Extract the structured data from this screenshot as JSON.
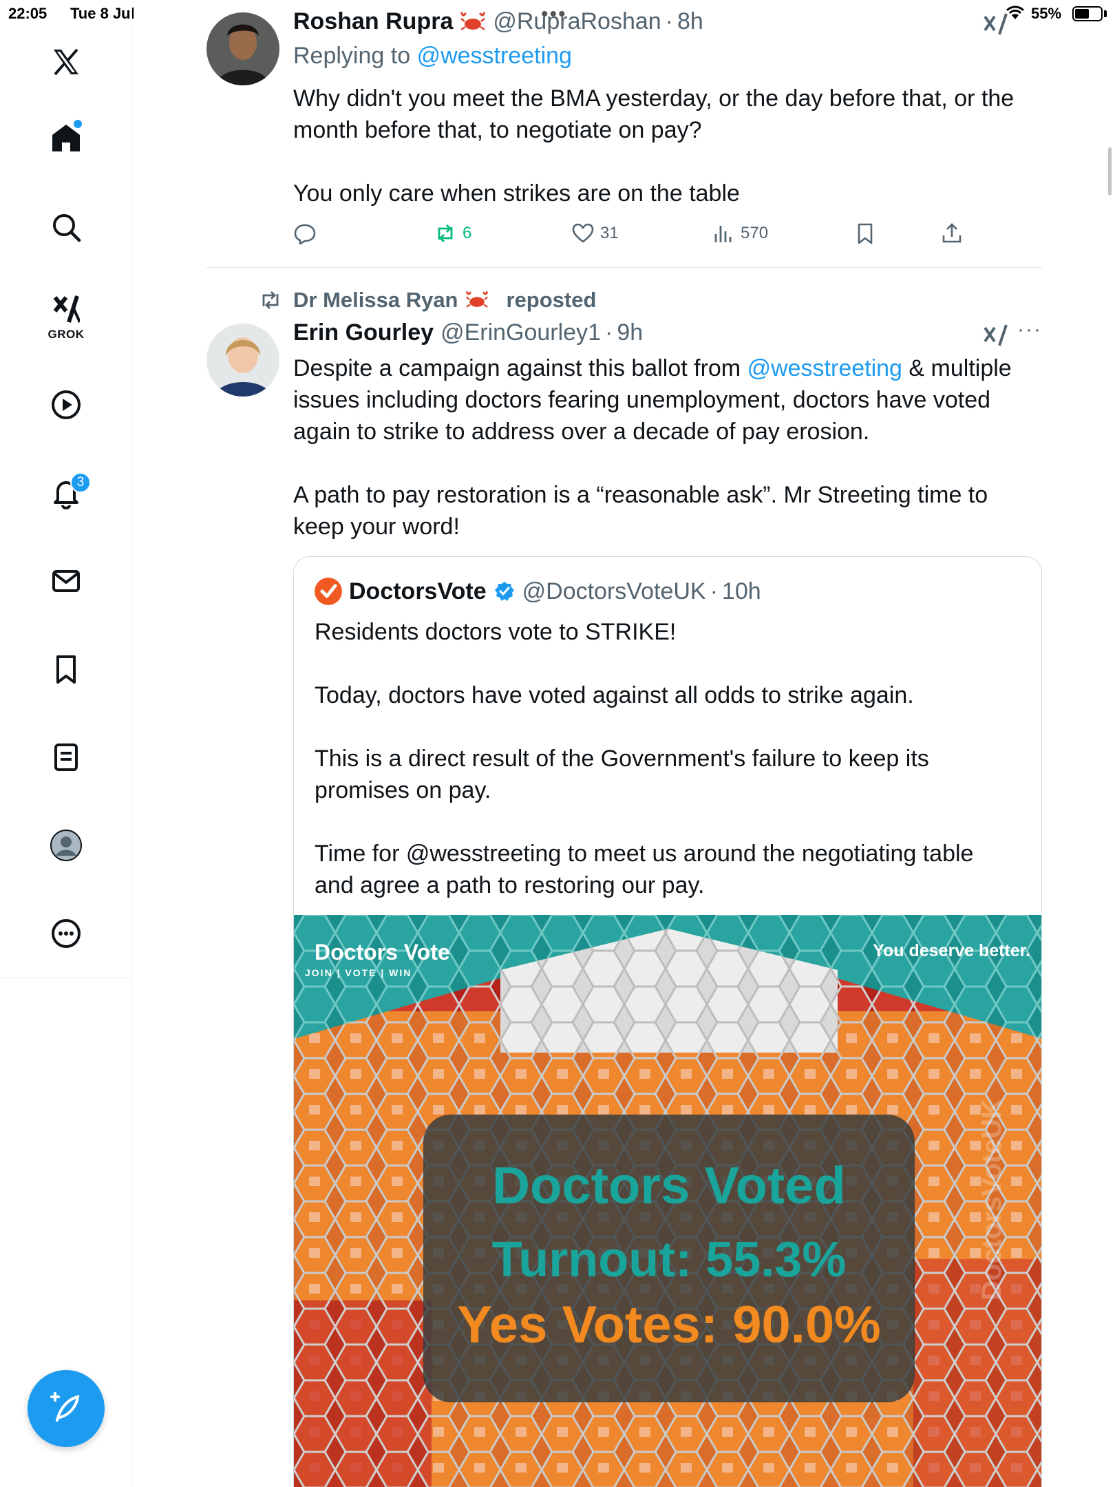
{
  "status_bar": {
    "time": "22:05",
    "date": "Tue 8 Jul",
    "battery": "55%"
  },
  "sidebar": {
    "grok_label": "GROK",
    "notifications_badge": "3"
  },
  "tweets": [
    {
      "name": "Roshan Rupra",
      "handle": "@RupraRoshan",
      "time": "8h",
      "replying_prefix": "Replying to",
      "replying_to": "@wesstreeting",
      "text": [
        "Why didn't you meet the BMA yesterday, or the day before that, or the month before that, to negotiate on pay?",
        "You only care when strikes are on the table"
      ],
      "stats": {
        "reposts": "6",
        "likes": "31",
        "views": "570"
      }
    },
    {
      "repost_by": "Dr Melissa Ryan",
      "repost_suffix": "reposted",
      "name": "Erin Gourley",
      "handle": "@ErinGourley1",
      "time": "9h",
      "text1_pre": "Despite a campaign against this ballot from ",
      "text1_mention": "@wesstreeting",
      "text1_post": " & multiple issues including doctors fearing unemployment, doctors have voted again to strike to address over a decade of pay erosion.",
      "text2": "A path to pay restoration is a “reasonable ask”. Mr Streeting time to keep your word!",
      "quote": {
        "name": "DoctorsVote",
        "handle": "@DoctorsVoteUK",
        "time": "10h",
        "text": [
          "Residents doctors vote to STRIKE!",
          "Today, doctors have voted against all odds to strike again.",
          "This is a direct result of the Government's failure to keep its promises on pay.",
          "Time for @wesstreeting to meet us around the negotiating table and agree a path to restoring our pay."
        ],
        "image": {
          "brand": "Doctors Vote",
          "tagline": "JOIN | VOTE | WIN",
          "slogan": "You deserve better.",
          "title": "Doctors Voted",
          "turnout": "Turnout: 55.3%",
          "yes_votes": "Yes Votes: 90.0%",
          "watermark": "DoctorsVoteUK"
        }
      }
    }
  ],
  "colors": {
    "accent": "#1d9bf0",
    "repost_green": "#00ba7c",
    "teal": "#1aa59c",
    "orange": "#f28a1f"
  }
}
